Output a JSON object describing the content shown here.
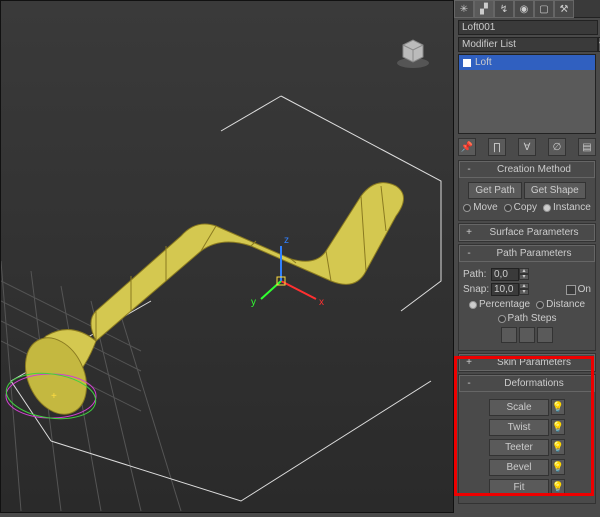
{
  "object_name": "Loft001",
  "modifier_list_label": "Modifier List",
  "stack_item": "Loft",
  "rollups": {
    "creation": {
      "title": "Creation Method",
      "get_path": "Get Path",
      "get_shape": "Get Shape",
      "move": "Move",
      "copy": "Copy",
      "instance": "Instance"
    },
    "surface": {
      "title": "Surface Parameters"
    },
    "path": {
      "title": "Path Parameters",
      "path_label": "Path:",
      "path_val": "0,0",
      "snap_label": "Snap:",
      "snap_val": "10,0",
      "on_label": "On",
      "percentage": "Percentage",
      "distance": "Distance",
      "pathsteps": "Path Steps"
    },
    "skin": {
      "title": "Skin Parameters"
    },
    "deform": {
      "title": "Deformations",
      "scale": "Scale",
      "twist": "Twist",
      "teeter": "Teeter",
      "bevel": "Bevel",
      "fit": "Fit"
    }
  }
}
